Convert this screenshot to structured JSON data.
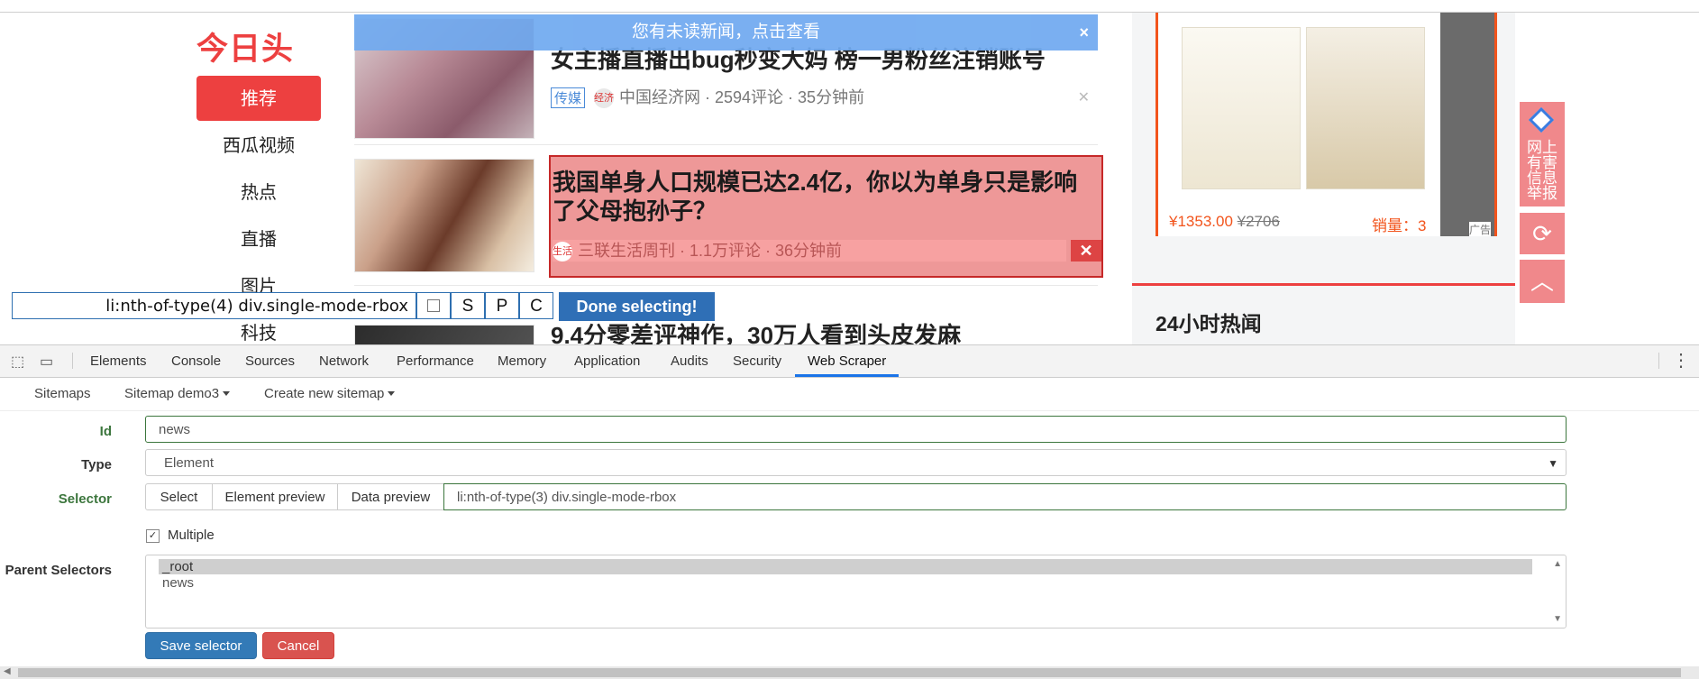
{
  "site": {
    "logo": "今日头条",
    "nav": [
      "推荐",
      "西瓜视频",
      "热点",
      "直播",
      "图片",
      "科技"
    ],
    "banner_text": "您有未读新闻，点击查看",
    "banner_close": "×"
  },
  "feed": [
    {
      "title": "女主播直播出bug秒变大妈 榜一男粉丝注销账号",
      "tag": "传媒",
      "source_icon": "经济",
      "meta": "中国经济网 · 2594评论 · 35分钟前",
      "dismiss": "✕"
    },
    {
      "title": "我国单身人口规模已达2.4亿，你以为单身只是影响了父母抱孙子？",
      "source_icon": "生活",
      "meta": "三联生活周刊 · 1.1万评论 · 36分钟前",
      "dismiss": "✕"
    },
    {
      "title": "9.4分零差评神作，30万人看到头皮发麻"
    }
  ],
  "ad": {
    "price": "¥1353.00",
    "old_price": "¥2706",
    "sales": "销量：3",
    "label": "广告"
  },
  "hot": {
    "title": "24小时热闻"
  },
  "side": {
    "report": "网上有害信息举报",
    "refresh_icon": "⟳",
    "top_icon": "︿"
  },
  "selector_bar": {
    "value": "li:nth-of-type(4) div.single-mode-rbox",
    "s": "S",
    "p": "P",
    "c": "C",
    "done": "Done selecting!"
  },
  "devtools": {
    "tabs": [
      "Elements",
      "Console",
      "Sources",
      "Network",
      "Performance",
      "Memory",
      "Application",
      "Audits",
      "Security",
      "Web Scraper"
    ],
    "active_tab": "Web Scraper"
  },
  "scraper": {
    "nav": {
      "sitemaps": "Sitemaps",
      "sitemap_demo": "Sitemap demo3",
      "create": "Create new sitemap"
    },
    "form": {
      "id_label": "Id",
      "id_value": "news",
      "type_label": "Type",
      "type_value": "Element",
      "selector_label": "Selector",
      "select_btn": "Select",
      "element_preview_btn": "Element preview",
      "data_preview_btn": "Data preview",
      "selector_value": "li:nth-of-type(3) div.single-mode-rbox",
      "multiple_label": "Multiple",
      "multiple_checked": "✓",
      "parent_label": "Parent Selectors",
      "parents": [
        "_root",
        "news"
      ],
      "save": "Save selector",
      "cancel": "Cancel"
    }
  }
}
